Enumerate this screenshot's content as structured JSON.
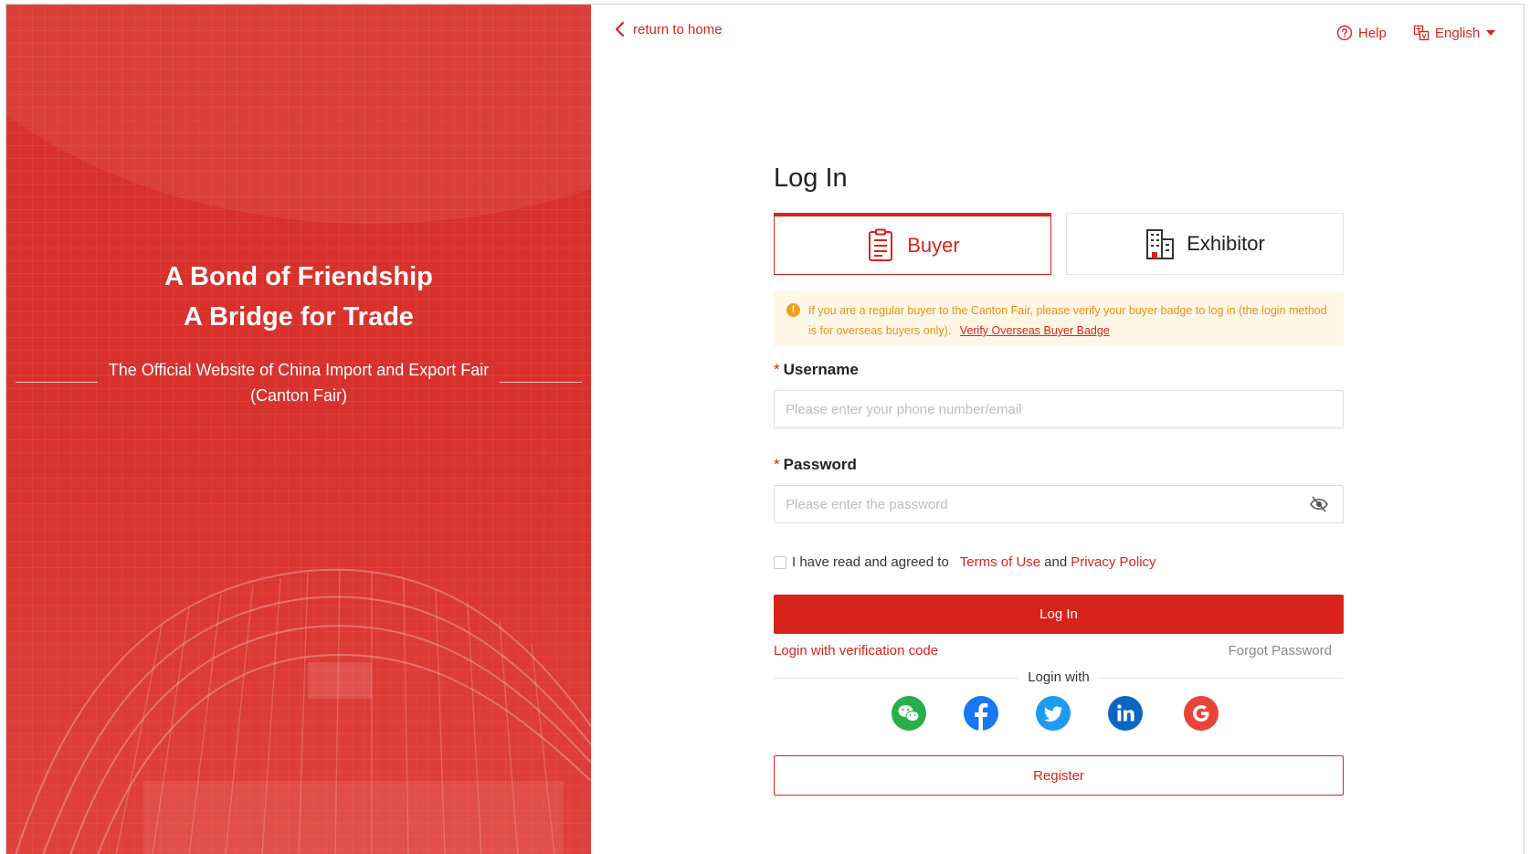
{
  "hero": {
    "title_line1": "A Bond of Friendship",
    "title_line2": "A Bridge for Trade",
    "subtitle": "The Official Website of China Import and Export Fair (Canton Fair)"
  },
  "topbar": {
    "back_label": "return to home",
    "help_label": "Help",
    "language": "English"
  },
  "login": {
    "title": "Log In",
    "tabs": [
      {
        "label": "Buyer",
        "icon": "document-icon",
        "active": true
      },
      {
        "label": "Exhibitor",
        "icon": "building-icon",
        "active": false
      }
    ],
    "notice": {
      "text": "If you are a regular buyer to the Canton Fair, please verify your buyer badge to log in (the login method is for overseas buyers only).",
      "link": "Verify Overseas Buyer Badge"
    },
    "username": {
      "label": "Username",
      "placeholder": "Please enter your phone number/email",
      "value": ""
    },
    "password": {
      "label": "Password",
      "placeholder": "Please enter the password",
      "value": ""
    },
    "agreement": {
      "prefix": "I have read and agreed to",
      "terms": "Terms of Use",
      "and": "and",
      "privacy": "Privacy Policy",
      "checked": false
    },
    "login_button": "Log In",
    "verification_link": "Login with verification code",
    "forgot_link": "Forgot Password",
    "login_with": "Login with",
    "social": [
      "wechat-icon",
      "facebook-icon",
      "twitter-icon",
      "linkedin-icon",
      "google-icon"
    ],
    "register_button": "Register"
  },
  "colors": {
    "brand_red": "#d8231c",
    "panel_red": "#d8312c",
    "notice_bg": "#fff7e6",
    "notice_text": "#e8901a"
  }
}
